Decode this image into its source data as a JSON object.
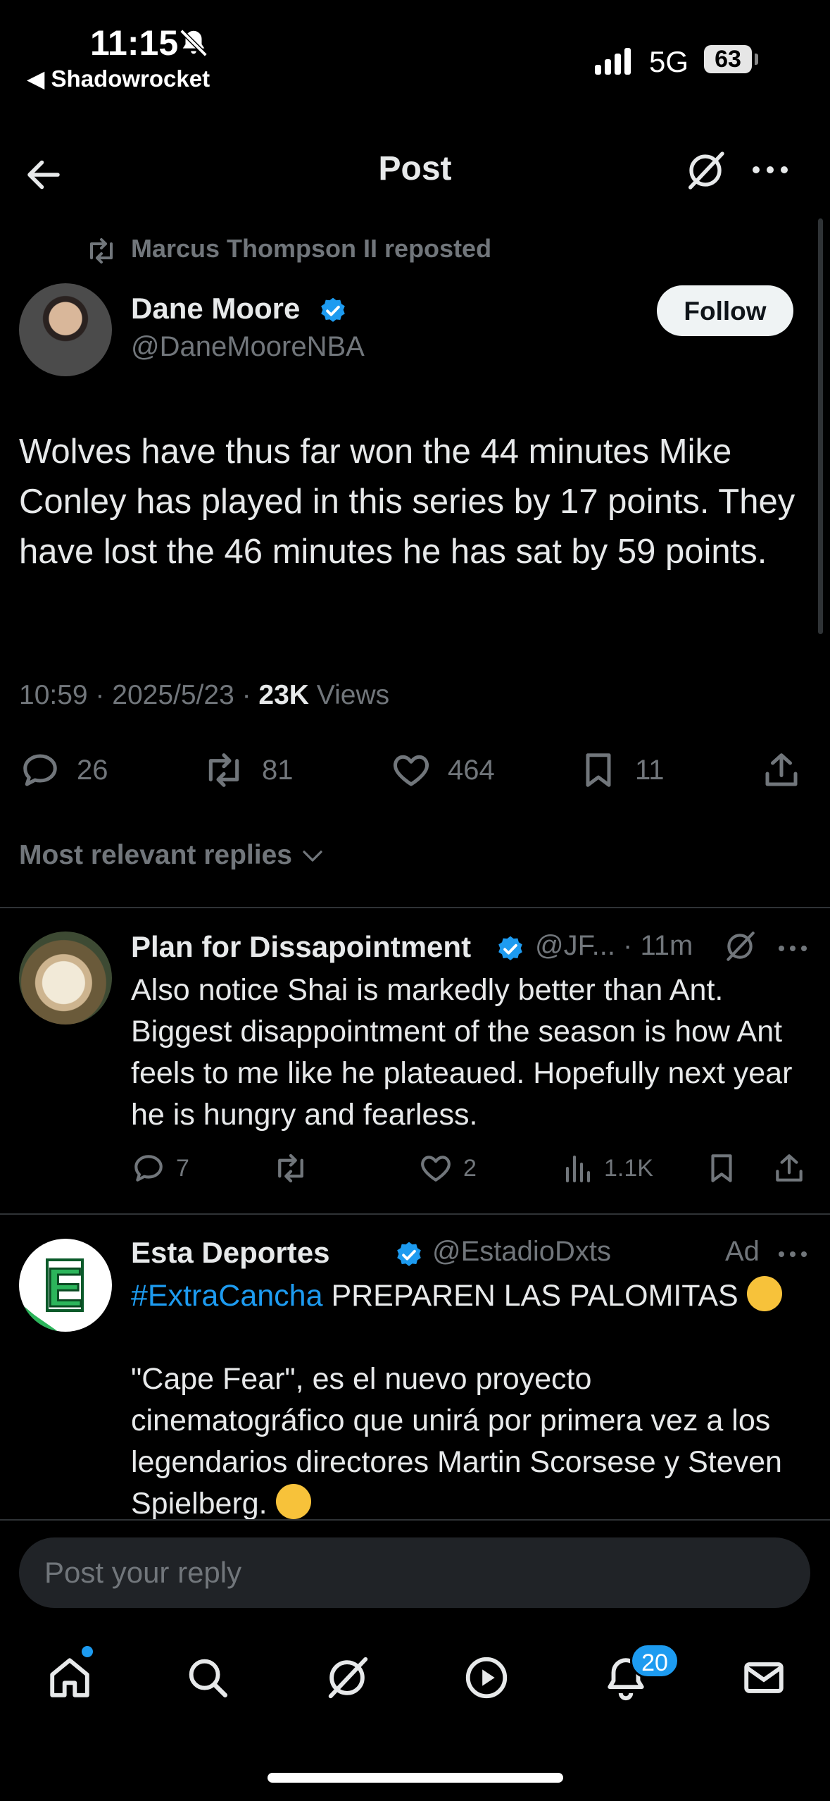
{
  "status_bar": {
    "time": "11:15",
    "back_app": "◀ Shadowrocket",
    "network": "5G",
    "battery": "63"
  },
  "header": {
    "title": "Post"
  },
  "repost": {
    "text": "Marcus Thompson II reposted"
  },
  "tweet": {
    "author_name": "Dane Moore",
    "author_handle": "@DaneMooreNBA",
    "follow_label": "Follow",
    "text": "Wolves have thus far won the 44 minutes Mike Conley has played in this series by 17 points. They have lost the 46 minutes he has sat by 59 points.",
    "time": "10:59 · 2025/5/23 · ",
    "views_count": "23K",
    "views_label": " Views",
    "actions": {
      "replies": "26",
      "reposts": "81",
      "likes": "464",
      "bookmarks": "11"
    }
  },
  "replies_filter": "Most relevant replies",
  "replies": [
    {
      "name": "Plan for Dissapointment",
      "handle": "@JF... · 11m",
      "text": "Also notice Shai is markedly better than Ant. Biggest disappointment of the season is how Ant feels to me like he plateaued. Hopefully next year he is hungry and fearless.",
      "replies": "7",
      "reposts": "",
      "likes": "2",
      "views": "1.1K"
    },
    {
      "name": "Esta   Deportes",
      "handle": "@EstadioDxts",
      "ad_label": "Ad",
      "hashtag": "#ExtraCancha",
      "headline": " PREPAREN LAS PALOMITAS ",
      "body": "\"Cape Fear\", es el nuevo proyecto cinematográfico que unirá por primera vez a los legendarios directores Martin Scorsese y Steven Spielberg. ",
      "avatar_letter": "E"
    }
  ],
  "composer": {
    "placeholder": "Post your reply"
  },
  "bottom_nav": {
    "notifications_badge": "20"
  },
  "colors": {
    "accent": "#1d9bf0",
    "muted": "#71767b",
    "text": "#e7e9ea",
    "background": "#000000"
  },
  "icons": [
    "back-arrow-icon",
    "grok-icon",
    "more-icon",
    "repost-icon",
    "verified-icon",
    "reply-icon",
    "like-icon",
    "bookmark-icon",
    "share-icon",
    "views-icon",
    "home-icon",
    "search-icon",
    "play-icon",
    "bell-icon",
    "mail-icon"
  ]
}
